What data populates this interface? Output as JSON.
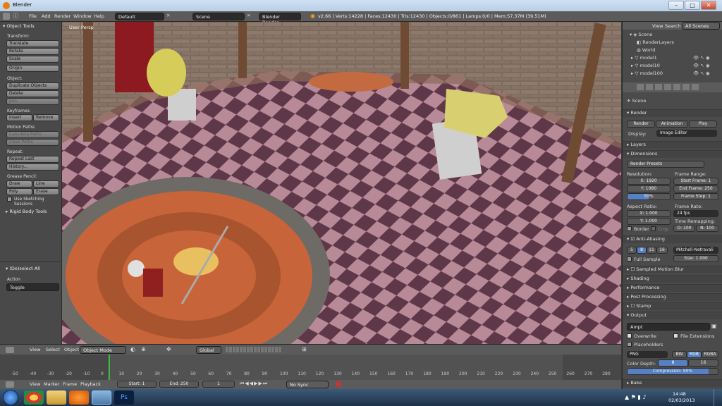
{
  "window": {
    "title": "Blender"
  },
  "topbar": {
    "menus": [
      "File",
      "Add",
      "Render",
      "Window",
      "Help"
    ],
    "layout": "Default",
    "scene": "Scene",
    "engine": "Blender Render",
    "stats": "v2.66 | Verts:14228 | Faces:12430 | Tris:12430 | Objects:0/861 | Lamps:0/0 | Mem:57.37M (39.51M)"
  },
  "tools": {
    "header": "Object Tools",
    "transform": {
      "label": "Transform:",
      "buttons": [
        "Translate",
        "Rotate",
        "Scale"
      ],
      "origin": "Origin"
    },
    "object": {
      "label": "Object:",
      "buttons": [
        "Duplicate Objects",
        "Delete",
        "Join"
      ]
    },
    "keyframes": {
      "label": "Keyframes:",
      "insert": "Insert",
      "remove": "Remove"
    },
    "motion": {
      "label": "Motion Paths:",
      "calculate": "Calculate Paths",
      "clear": "Clear Paths"
    },
    "repeat": {
      "label": "Repeat:",
      "last": "Repeat Last",
      "history": "History..."
    },
    "grease": {
      "label": "Grease Pencil:",
      "draw": "Draw",
      "line": "Line",
      "poly": "Poly",
      "erase": "Erase",
      "sketch": "Use Sketching Sessions"
    },
    "rigid": "Rigid Body Tools",
    "op_title": "(De)select All",
    "action_label": "Action",
    "action_value": "Toggle"
  },
  "viewport": {
    "label": "User Persp"
  },
  "vpheader": {
    "menus": [
      "View",
      "Select",
      "Object"
    ],
    "mode": "Object Mode",
    "orientation": "Global"
  },
  "timeline": {
    "ticks": [
      "-50",
      "-40",
      "-30",
      "-20",
      "-10",
      "0",
      "10",
      "20",
      "30",
      "40",
      "50",
      "60",
      "70",
      "80",
      "90",
      "100",
      "110",
      "120",
      "130",
      "140",
      "150",
      "160",
      "170",
      "180",
      "190",
      "200",
      "210",
      "220",
      "230",
      "240",
      "250",
      "260",
      "270",
      "280"
    ],
    "menus": [
      "View",
      "Marker",
      "Frame",
      "Playback"
    ],
    "start": "Start: 1",
    "end": "End: 250",
    "current": "1",
    "sync": "No Sync"
  },
  "outliner": {
    "menus": [
      "View",
      "Search"
    ],
    "filter": "All Scenes",
    "items": [
      "Scene",
      "RenderLayers",
      "World",
      "model1",
      "model10",
      "model100"
    ]
  },
  "props": {
    "scene_label": "Scene",
    "render": {
      "header": "Render",
      "render_btn": "Render",
      "animation_btn": "Animation",
      "play_btn": "Play",
      "display_label": "Display:",
      "display_value": "Image Editor"
    },
    "layers": "Layers",
    "dimensions": {
      "header": "Dimensions",
      "presets": "Render Presets",
      "resolution": "Resolution:",
      "res_x": "X: 1920",
      "res_y": "Y: 1080",
      "res_pct": "50%",
      "frame_range": "Frame Range:",
      "start": "Start Frame: 1",
      "end": "End Frame: 250",
      "step": "Frame Step: 1",
      "aspect": "Aspect Ratio:",
      "asp_x": "X: 1.000",
      "asp_y": "Y: 1.000",
      "frame_rate": "Frame Rate:",
      "fps": "24 fps",
      "remap": "Time Remapping:",
      "remap_old": "O: 100",
      "remap_new": "N: 100",
      "border": "Border",
      "crop": "Crop"
    },
    "aa": {
      "header": "Anti-Aliasing",
      "levels": [
        "5",
        "8",
        "11",
        "16"
      ],
      "filter": "Mitchell-Netravali",
      "full": "Full Sample",
      "size": "Size: 1.000"
    },
    "sections": [
      "Sampled Motion Blur",
      "Shading",
      "Performance",
      "Post Processing",
      "Stamp"
    ],
    "output": {
      "header": "Output",
      "path": "Ampt",
      "overwrite": "Overwrite",
      "extensions": "File Extensions",
      "placeholders": "Placeholders",
      "format": "PNG",
      "bw": "BW",
      "rgb": "RGB",
      "rgba": "RGBA",
      "depth_label": "Color Depth:",
      "depth8": "8",
      "depth16": "16",
      "compression": "Compression: 90%"
    },
    "bake": "Bake"
  },
  "taskbar": {
    "time": "14:48",
    "date": "02/03/2013"
  }
}
